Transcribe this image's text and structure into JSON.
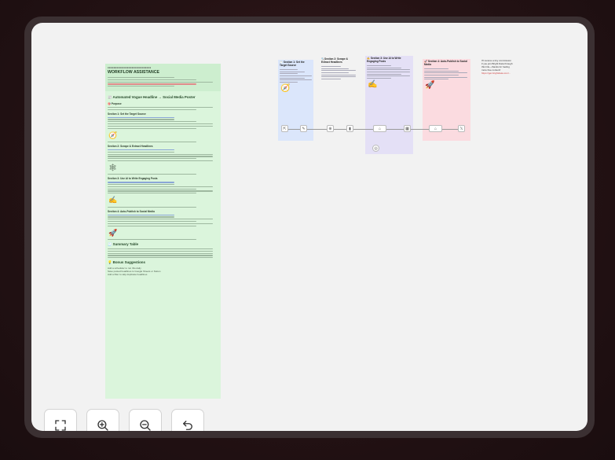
{
  "note": {
    "header_dots": "▪▪▪▪▪▪▪▪▪▪▪▪▪▪▪▪▪▪▪▪▪▪▪▪▪▪▪▪▪",
    "header_title": "WORKFLOW ASSISTANCE",
    "main_title": "📰 Automated Vogue Headline → Social Media Poster",
    "purpose_label": "🎯 Purpose",
    "sections": [
      {
        "emoji": "🕒",
        "title": "Section 1: Set the Target Source"
      },
      {
        "emoji": "🔍",
        "title": "Section 2: Scrape & Extract Headlines"
      },
      {
        "emoji": "✍️",
        "title": "Section 3: Use AI to Write Engaging Posts"
      },
      {
        "emoji": "🚀",
        "title": "Section 4: Auto-Publish to Social Media"
      }
    ],
    "summary_title": "🧾 Summary Table",
    "bonus_title": "💡 Bonus Suggestions",
    "bonus_items": [
      "Add a scheduler to run this daily",
      "Save posted headlines to Google Sheets or Notion",
      "Add a filter to skip duplicate headlines"
    ]
  },
  "workflow": {
    "sections": [
      {
        "title": "🕒 Section 1: Set the Target Source"
      },
      {
        "title": "🔍Section 2: Scrape & Extract Headlines"
      },
      {
        "title": "✍️ Section 3: Use AI to Write Engaging Posts"
      },
      {
        "title": "🚀 Section 4: Auto-Publish to Social Media"
      }
    ],
    "side_note": "I'll receive a tiny commission if you join Bright Data through this link—thanks for fueling more free content!",
    "side_link": "https://get.brightdata.com/..."
  },
  "toolbar": {
    "fit": "fit-view",
    "zoom_in": "zoom-in",
    "zoom_out": "zoom-out",
    "undo": "undo"
  }
}
